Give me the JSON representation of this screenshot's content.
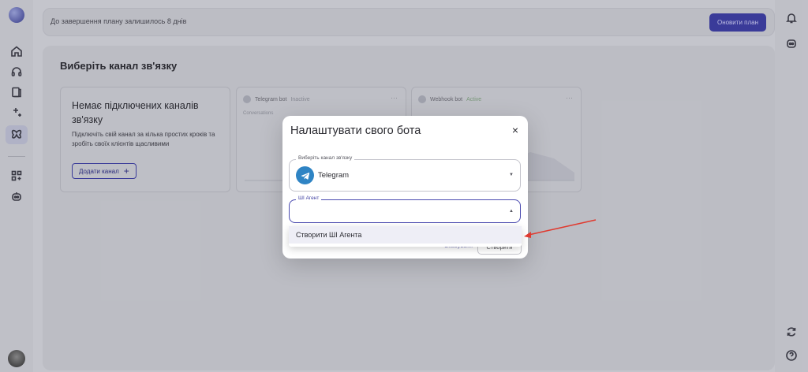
{
  "colors": {
    "accent": "#3c3da0",
    "telegram": "#2f84c4",
    "annotation_arrow": "#e03a2f",
    "active_status": "#7fa07e"
  },
  "left_rail": {
    "icons": [
      "logo-icon",
      "home-icon",
      "headset-icon",
      "book-icon",
      "sparkle-icon",
      "butterfly-icon",
      "grid-add-icon",
      "bot-icon"
    ],
    "active": "butterfly-icon"
  },
  "right_rail": {
    "icons": [
      "notification-bell-icon",
      "bot-face-icon",
      "refresh-icon",
      "help-icon"
    ]
  },
  "topbar": {
    "plan_notice": "До завершення плану залишилось 8 днів",
    "upgrade_button": "Оновити план"
  },
  "main": {
    "title": "Виберіть канал зв'язку",
    "empty_card": {
      "title": "Немає підключених каналів зв'язку",
      "description": "Підключіть свій канал за кілька простих кроків та зробіть своїх клієнтів щасливими",
      "add_button": "Додати канал",
      "add_icon": "+"
    },
    "bot_cards": [
      {
        "name": "Telegram bot",
        "status": "Inactive",
        "menu": "···",
        "sub": "Conversations"
      },
      {
        "name": "Webhook bot",
        "status": "Active",
        "menu": "···"
      }
    ]
  },
  "modal": {
    "title": "Налаштувати свого бота",
    "close": "×",
    "channel_field": {
      "legend": "Виберіть канал зв'язку",
      "value": "Telegram",
      "caret": "▼"
    },
    "agent_field": {
      "legend": "ШІ Агент",
      "value": "",
      "caret": "▲"
    },
    "dropdown_options": [
      "Створити ШІ Агента"
    ],
    "footer": {
      "cancel": "Скасувати",
      "create": "Створити"
    }
  }
}
